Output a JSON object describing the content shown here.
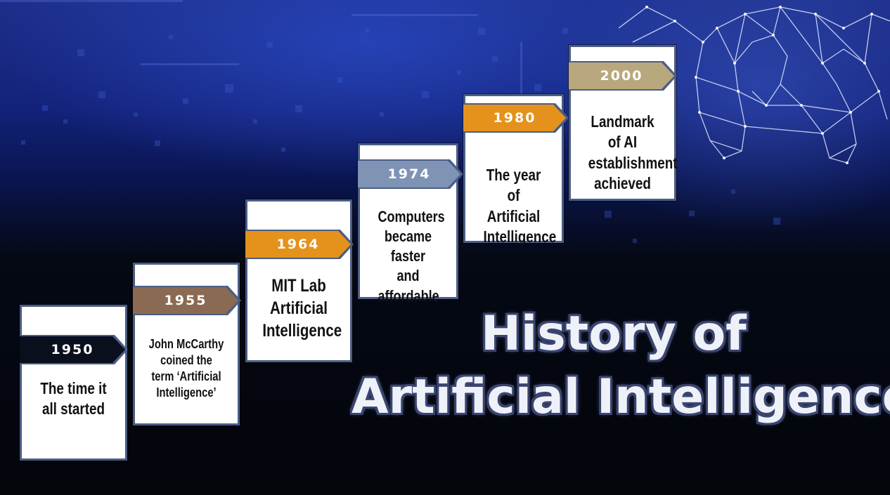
{
  "title": {
    "line1": "History of",
    "line2": "Artificial Intelligence"
  },
  "milestones": [
    {
      "year": "1950",
      "label": "The time it all started",
      "color": "#0a0f1e"
    },
    {
      "year": "1955",
      "label": "John McCarthy coined the term ‘Artificial Intelligence’",
      "color": "#8a6a52"
    },
    {
      "year": "1964",
      "label": "MIT Lab Artificial Intelligence",
      "color": "#e4921c"
    },
    {
      "year": "1974",
      "label": "Computers became faster and affordable",
      "color": "#7f93b4"
    },
    {
      "year": "1980",
      "label": "The year of Artificial Intelligence",
      "color": "#e4921c"
    },
    {
      "year": "2000",
      "label": "Landmark of AI establishment achieved",
      "color": "#b9a77d"
    }
  ]
}
